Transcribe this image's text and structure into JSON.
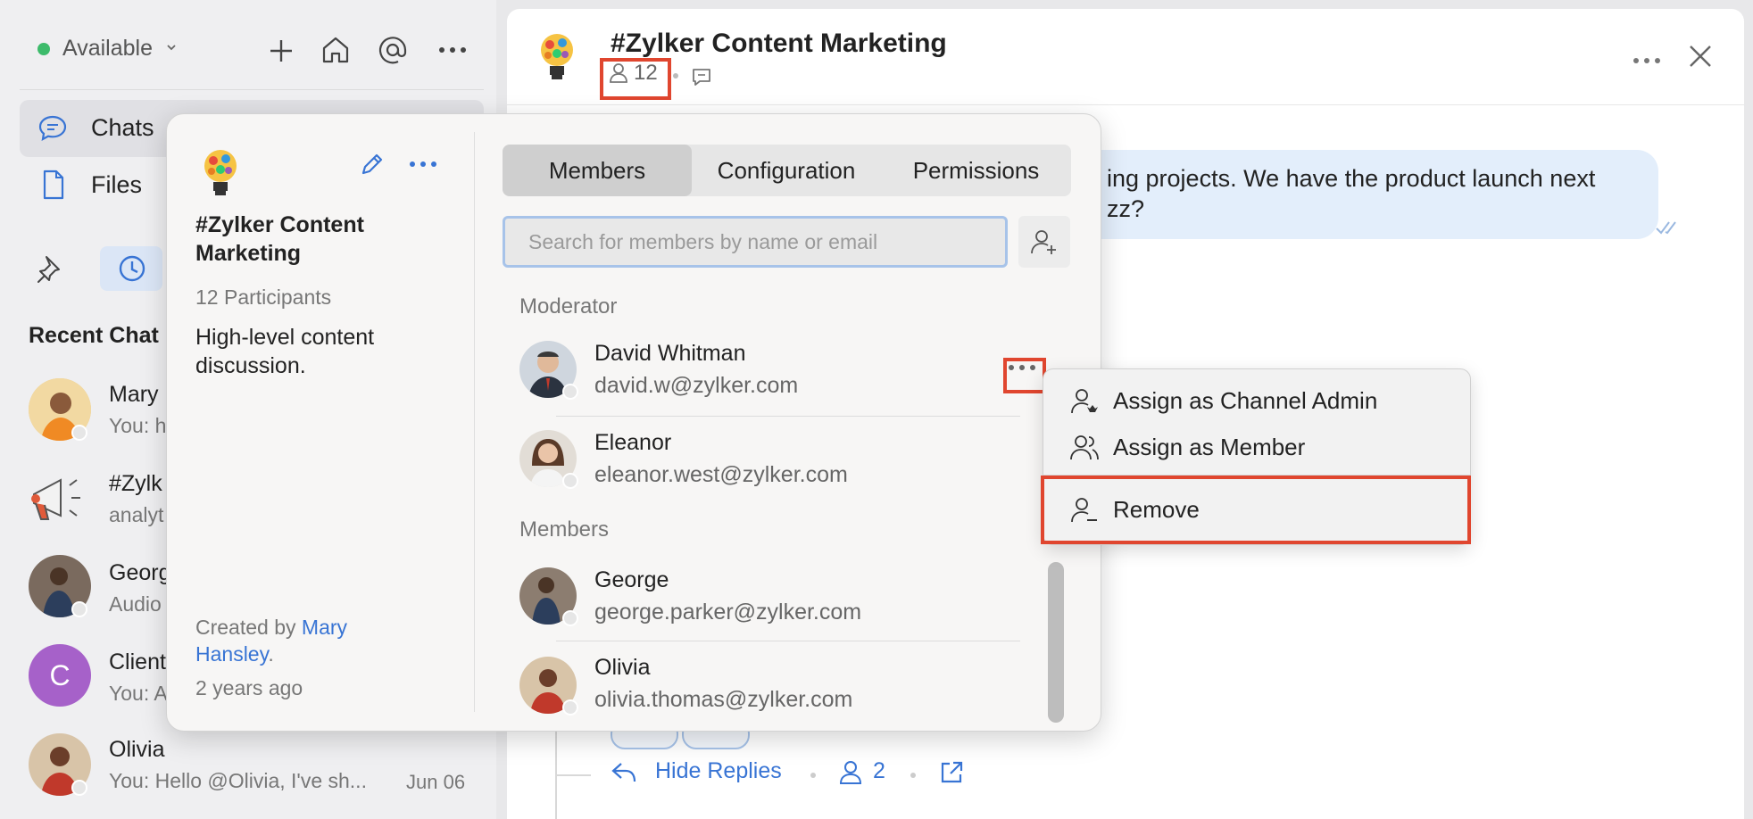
{
  "sidebar": {
    "status_label": "Available",
    "nav": [
      {
        "label": "Chats",
        "icon": "chat-bubble-icon"
      },
      {
        "label": "Files",
        "icon": "file-icon"
      }
    ],
    "recent_title": "Recent Chat",
    "chats": [
      {
        "name": "Mary",
        "preview": "You: h",
        "icon": "avatar"
      },
      {
        "name": "#Zylk",
        "preview": "analyt",
        "icon": "megaphone-icon"
      },
      {
        "name": "Georg",
        "preview": "Audio",
        "icon": "avatar"
      },
      {
        "name": "Client",
        "preview": "You: A",
        "initial": "C",
        "icon": "avatar"
      },
      {
        "name": "Olivia",
        "preview": "You: Hello @Olivia, I've sh...",
        "time": "Jun 06",
        "icon": "avatar"
      }
    ]
  },
  "header": {
    "title": "#Zylker Content Marketing",
    "member_count": "12"
  },
  "chat": {
    "bubble_line1": "ing projects. We have the product launch next",
    "bubble_line2": "zz?",
    "hide_replies": "Hide Replies",
    "reply_count": "2"
  },
  "popover": {
    "title": "#Zylker Content Marketing",
    "participants": "12 Participants",
    "description": "High-level content discussion.",
    "created_by_prefix": "Created by ",
    "creator_line1": "Mary",
    "creator_line2": "Hansley",
    "created_suffix": ".",
    "created_ago": "2 years ago",
    "tabs": [
      "Members",
      "Configuration",
      "Permissions"
    ],
    "search_placeholder": "Search for members by name or email",
    "moderator_heading": "Moderator",
    "members_heading": "Members",
    "moderators": [
      {
        "name": "David Whitman",
        "email": "david.w@zylker.com"
      },
      {
        "name": "Eleanor",
        "email": "eleanor.west@zylker.com"
      }
    ],
    "members": [
      {
        "name": "George",
        "email": "george.parker@zylker.com"
      },
      {
        "name": "Olivia",
        "email": "olivia.thomas@zylker.com"
      }
    ]
  },
  "context_menu": {
    "items": [
      {
        "label": "Assign as Channel Admin",
        "icon": "user-admin-icon"
      },
      {
        "label": "Assign as Member",
        "icon": "users-icon"
      },
      {
        "label": "Remove",
        "icon": "user-remove-icon"
      }
    ]
  },
  "colors": {
    "accent": "#3874d4",
    "highlight": "#e0462f",
    "status": "#3dbb6b"
  }
}
